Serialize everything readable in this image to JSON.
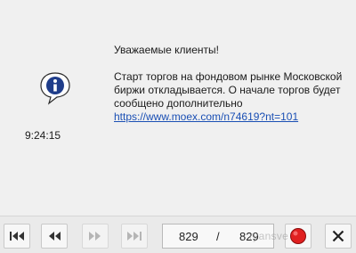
{
  "message": {
    "time": "9:24:15",
    "greeting": "Уважаемые клиенты!",
    "body": "Старт торгов на фондовом рынке Московской биржи откладывается. О начале торгов будет сообщено дополнительно",
    "link": "https://www.moex.com/n74619?nt=101",
    "icon": "info-icon"
  },
  "toolbar": {
    "current": "829",
    "separator": "/",
    "total": "829",
    "first_icon": "skip-to-first-icon",
    "prev_icon": "step-back-icon",
    "next_icon": "step-forward-icon",
    "last_icon": "skip-to-last-icon",
    "stop_icon": "red-stop-icon",
    "close_icon": "close-icon"
  },
  "watermark": "ryansve",
  "colors": {
    "link": "#1a4fb4",
    "stop_red": "#e02020",
    "icon_blue": "#1f3d8a"
  }
}
